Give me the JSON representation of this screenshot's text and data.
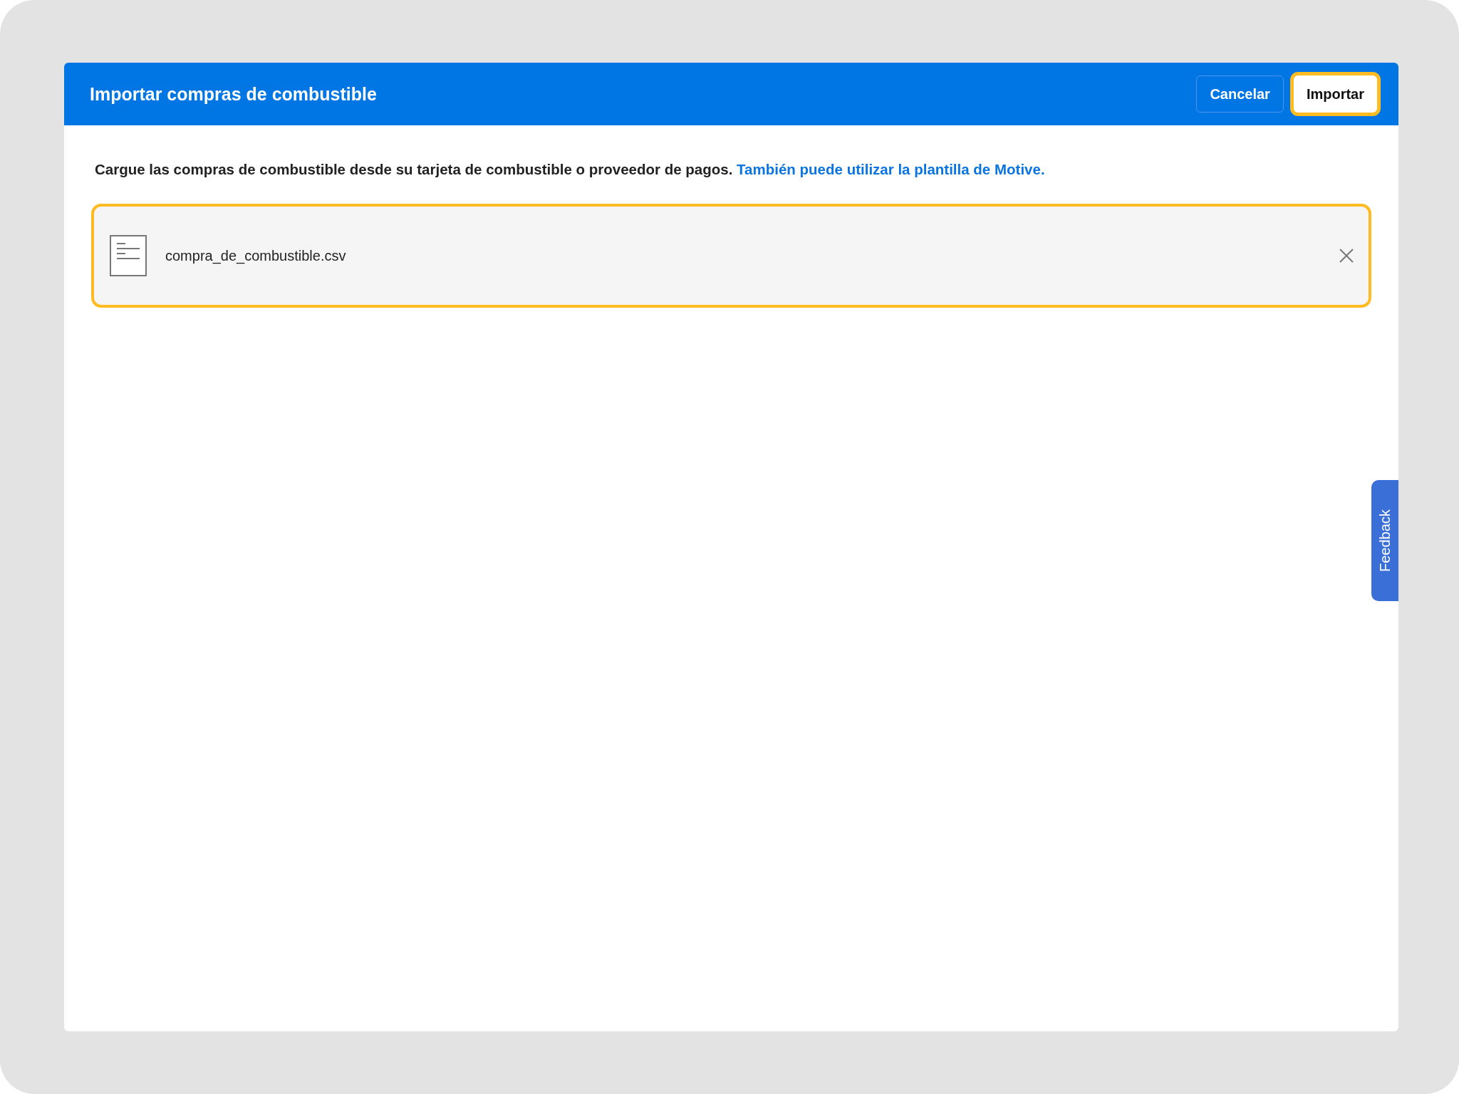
{
  "dialog": {
    "title": "Importar compras de combustible",
    "buttons": [
      {
        "kind": "secondary",
        "label": "Cancelar",
        "focused": false
      },
      {
        "kind": "primary",
        "label": "Importar",
        "focused": true
      }
    ]
  },
  "description": {
    "text": "Cargue las compras de combustible desde su tarjeta de combustible o proveedor de pagos.",
    "link": "También puede utilizar la plantilla de Motive."
  },
  "file": {
    "name": "compra_de_combustible.csv",
    "focused": true
  },
  "feedback_tab": {
    "label": "Feedback"
  }
}
